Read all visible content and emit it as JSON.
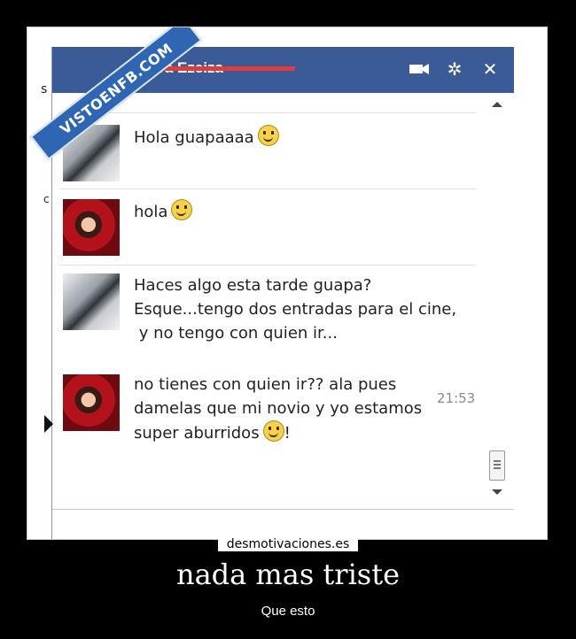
{
  "window": {
    "contact_name": "Laura Ezeiza",
    "icons": [
      "video-camera-icon",
      "gear-icon",
      "close-icon"
    ]
  },
  "watermark": "VISTOENFB.COM",
  "left_stub": {
    "top": "s",
    "mid": "c"
  },
  "messages": [
    {
      "sender": "other",
      "avatar": "boy-avatar",
      "lines": [
        "Hola guapaaaa"
      ],
      "smiley_end": true
    },
    {
      "sender": "me",
      "avatar": "girl-avatar",
      "lines": [
        "hola"
      ],
      "smiley_end": true
    },
    {
      "sender": "other",
      "avatar": "boy-avatar",
      "lines": [
        "Haces algo esta tarde guapa?",
        "Esque...tengo dos entradas para el cine,",
        " y no tengo con quien ir..."
      ]
    },
    {
      "sender": "me",
      "avatar": "girl-avatar",
      "lines": [
        "no tienes con quien ir?? ala pues",
        "damelas que mi novio y yo estamos",
        "super aburridos",
        "!"
      ]
    }
  ],
  "timestamp": "21:53",
  "poster": {
    "site": "desmotivaciones.es",
    "title": "nada mas triste",
    "subtitle": "Que esto"
  }
}
